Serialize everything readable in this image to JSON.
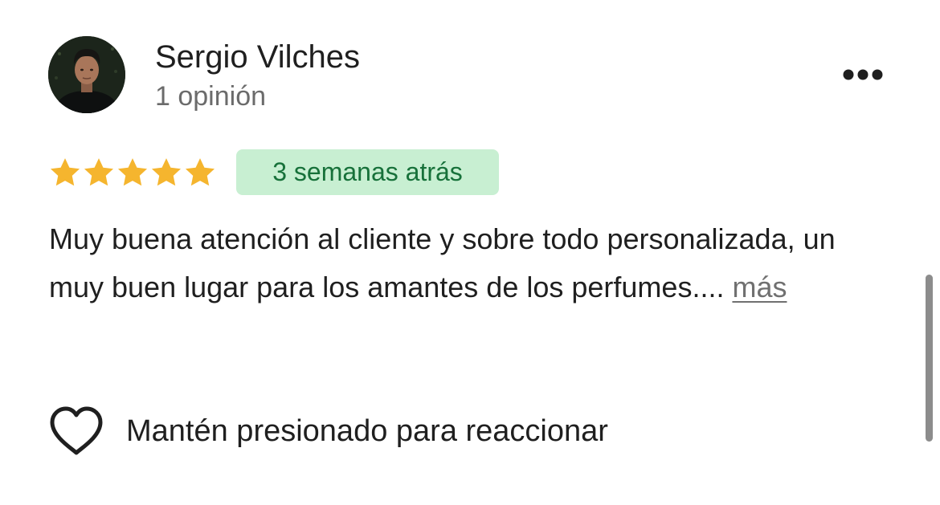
{
  "reviewer": {
    "name": "Sergio Vilches",
    "meta": "1 opinión",
    "avatar_icon": "profile-photo"
  },
  "menu": {
    "icon": "more-horizontal-icon"
  },
  "review": {
    "rating": 5,
    "rating_max": 5,
    "star_color": "#f5b52e",
    "date": "3 semanas atrás",
    "date_badge_bg": "#c8efd2",
    "date_badge_fg": "#17713a",
    "text": "Muy buena atención al cliente y sobre todo personalizada, un muy buen lugar para los amantes de los perfumes.... ",
    "more_label": "más"
  },
  "reaction": {
    "icon": "heart-outline-icon",
    "label": "Mantén presionado para reaccionar"
  }
}
